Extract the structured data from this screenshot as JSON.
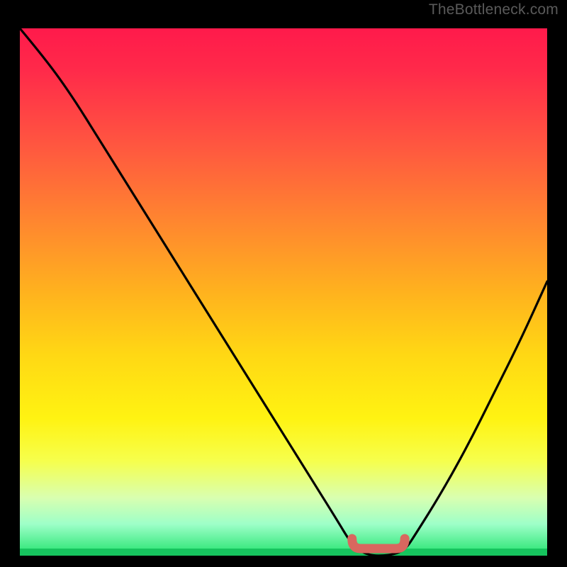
{
  "watermark": "TheBottleneck.com",
  "colors": {
    "frame": "#000000",
    "curve": "#000000",
    "marker": "#d9675f",
    "gradient_top": "#ff1a4b",
    "gradient_bottom": "#22e36e"
  },
  "chart_data": {
    "type": "line",
    "title": "",
    "xlabel": "",
    "ylabel": "",
    "xlim": [
      0,
      100
    ],
    "ylim": [
      0,
      100
    ],
    "grid": false,
    "legend": false,
    "series": [
      {
        "name": "bottleneck-curve",
        "x": [
          0,
          5,
          10,
          15,
          20,
          25,
          30,
          35,
          40,
          45,
          50,
          55,
          60,
          63,
          66,
          70,
          73,
          75,
          80,
          85,
          90,
          95,
          100
        ],
        "y": [
          100,
          94,
          87,
          79,
          71,
          63,
          55,
          47,
          39,
          31,
          23,
          15,
          7,
          2,
          0,
          0,
          1,
          4,
          12,
          21,
          31,
          41,
          52
        ]
      }
    ],
    "optimal_range_x": [
      63,
      73
    ],
    "annotations": []
  }
}
